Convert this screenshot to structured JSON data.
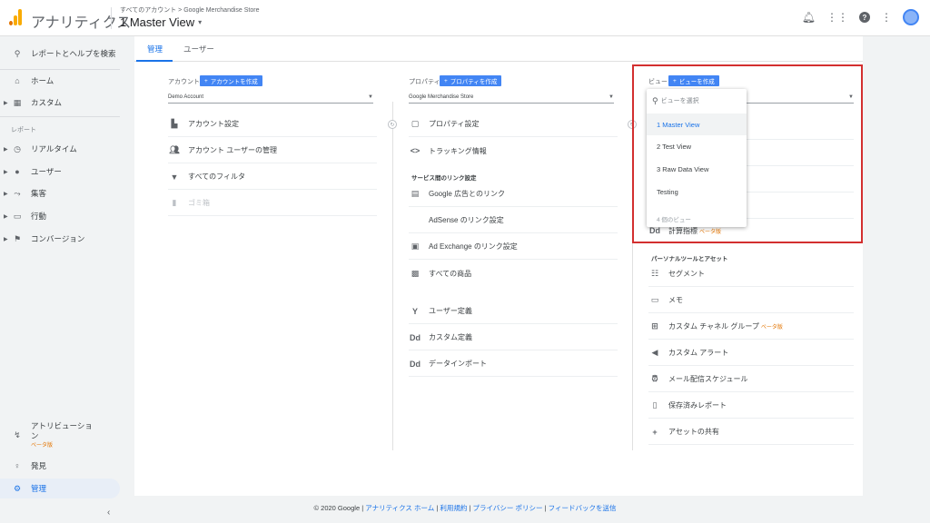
{
  "header": {
    "app_title": "アナリティクス",
    "breadcrumb": "すべてのアカウント > Google Merchandise Store",
    "view_title": "1 Master View",
    "help_icon": "?"
  },
  "sidebar": {
    "search": "レポートとヘルプを検索",
    "home": "ホーム",
    "custom": "カスタム",
    "reports_section": "レポート",
    "realtime": "リアルタイム",
    "users": "ユーザー",
    "acquisition": "集客",
    "behavior": "行動",
    "conversions": "コンバージョン",
    "attribution": "アトリビューション",
    "attribution_beta": "ベータ版",
    "discover": "発見",
    "admin": "管理"
  },
  "tabs": {
    "admin": "管理",
    "user": "ユーザー"
  },
  "account": {
    "label": "アカウント",
    "create_label": "アカウントを作成",
    "selected": "Demo Account",
    "items": {
      "settings": "アカウント設定",
      "user_management": "アカウント ユーザーの管理",
      "filters": "すべてのフィルタ",
      "trash": "ゴミ箱"
    }
  },
  "property": {
    "label": "プロパティ",
    "create_label": "プロパティを作成",
    "selected": "Google Merchandise Store",
    "items": {
      "settings": "プロパティ設定",
      "tracking": "トラッキング情報",
      "product_linking_title": "サービス間のリンク設定",
      "google_ads": "Google 広告とのリンク",
      "adsense": "AdSense のリンク設定",
      "ad_exchange": "Ad Exchange のリンク設定",
      "all_products": "すべての商品",
      "user_definitions": "ユーザー定義",
      "custom_definitions": "カスタム定義",
      "data_import": "データインポート"
    }
  },
  "view": {
    "label": "ビュー",
    "create_label": "ビューを作成",
    "items": {
      "calculated_metrics": "計算指標",
      "calculated_metrics_beta": "ベータ版",
      "personal_tools_title": "パーソナルツールとアセット",
      "segments": "セグメント",
      "annotations": "メモ",
      "custom_channel_grouping": "カスタム チャネル グループ",
      "custom_channel_beta": "ベータ版",
      "custom_alerts": "カスタム アラート",
      "scheduled_emails": "メール配信スケジュール",
      "saved_reports": "保存済みレポート",
      "share_assets": "アセットの共有"
    }
  },
  "view_dropdown": {
    "placeholder": "ビューを選択",
    "options": [
      "1 Master View",
      "2 Test View",
      "3 Raw Data View",
      "Testing"
    ],
    "selected_index": 0,
    "footer": "4 個のビュー"
  },
  "footer": {
    "copyright": "© 2020 Google | ",
    "links": [
      "アナリティクス ホーム",
      "利用規約",
      "プライバシー ポリシー",
      "フィードバックを送信"
    ]
  },
  "colors": {
    "accent": "#1a73e8",
    "highlight_border": "#d32f2f",
    "create_button": "#4285f4"
  }
}
